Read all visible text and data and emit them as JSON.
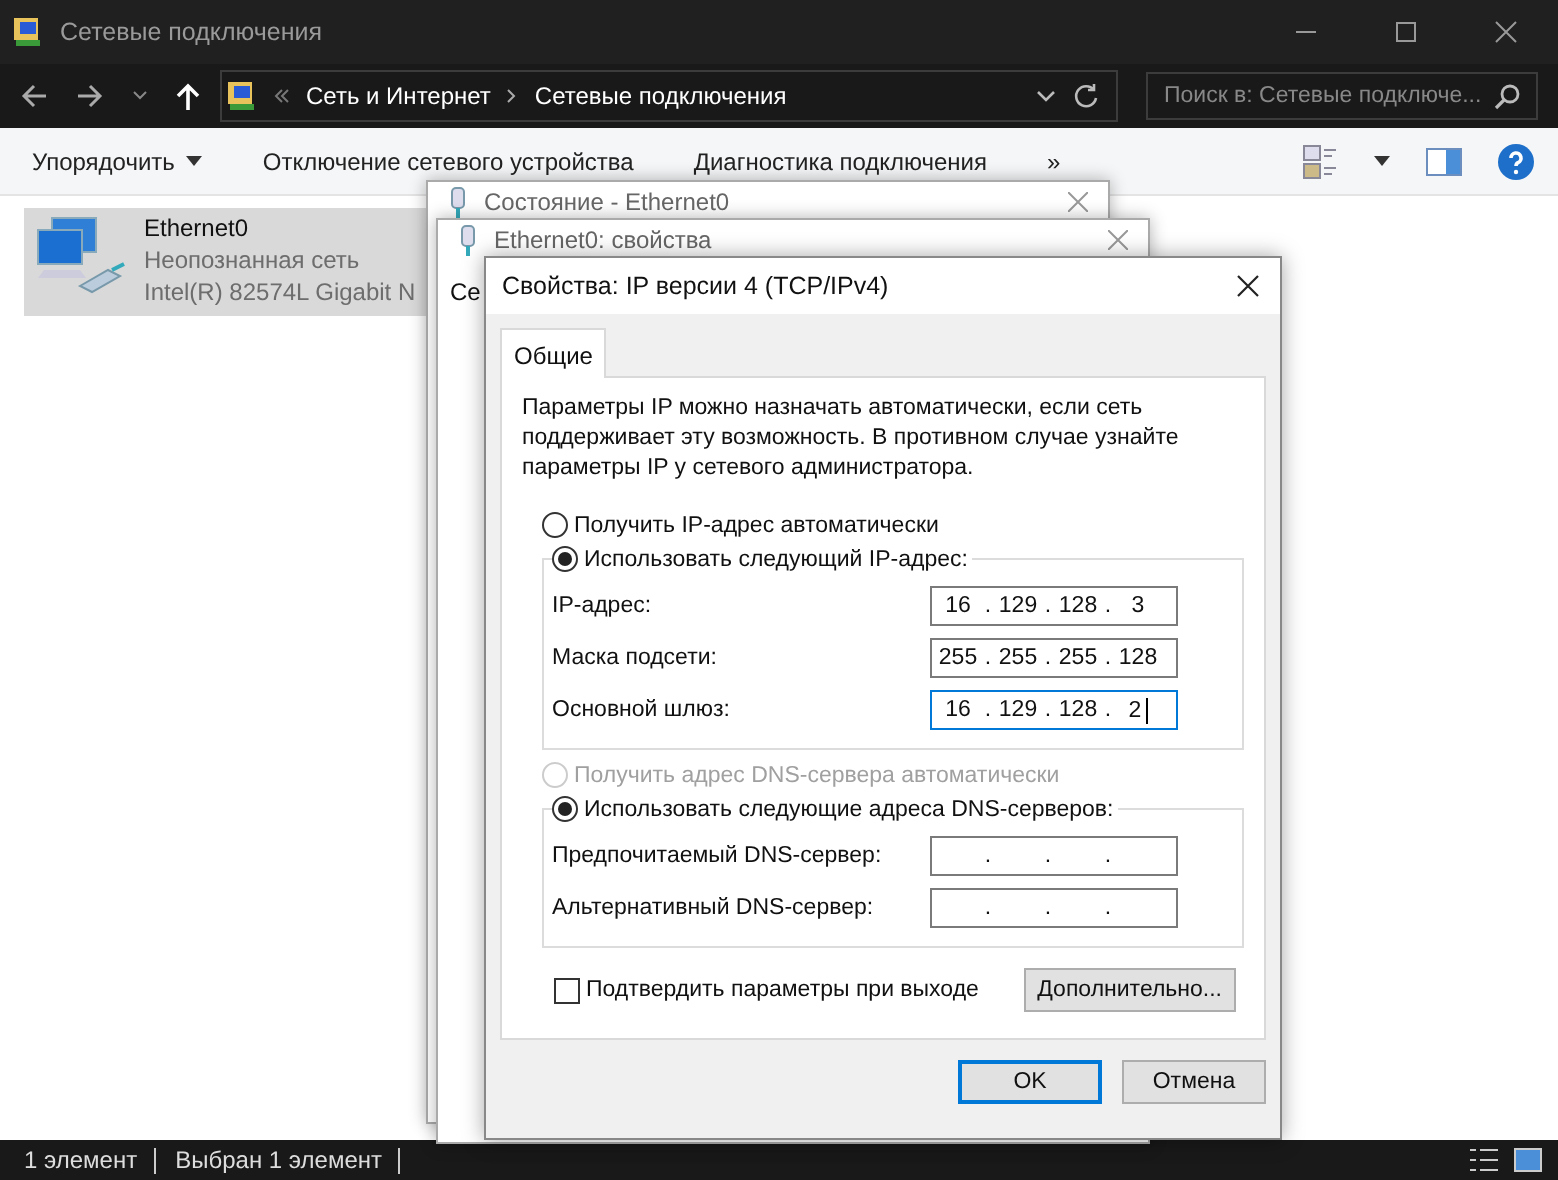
{
  "window": {
    "title": "Сетевые подключения"
  },
  "address": {
    "crumbs": [
      "Сеть и Интернет",
      "Сетевые подключения"
    ],
    "search_placeholder": "Поиск в: Сетевые подключе..."
  },
  "commands": [
    "Упорядочить",
    "Отключение сетевого устройства",
    "Диагностика подключения",
    "»"
  ],
  "items": [
    {
      "name": "Ethernet0",
      "status": "Неопознанная сеть",
      "adapter": "Intel(R) 82574L Gigabit N",
      "selected": true
    }
  ],
  "back_dialogs": [
    {
      "title": "Состояние - Ethernet0"
    },
    {
      "title": "Ethernet0: свойства",
      "tab": "Се"
    }
  ],
  "dialog": {
    "title": "Свойства: IP версии 4 (TCP/IPv4)",
    "tabs": [
      {
        "label": "Общие",
        "selected": true
      }
    ],
    "intro": "Параметры IP можно назначать автоматически, если сеть поддерживает эту возможность. В противном случае узнайте параметры IP у сетевого администратора.",
    "ip_modes": [
      {
        "label": "Получить IP-адрес автоматически",
        "selected": false,
        "disabled": false
      },
      {
        "label": "Использовать следующий IP-адрес:",
        "selected": true,
        "disabled": false
      }
    ],
    "ip_fields": [
      {
        "label": "IP-адрес:",
        "octets": [
          "16",
          "129",
          "128",
          "3"
        ],
        "focused": false
      },
      {
        "label": "Маска подсети:",
        "octets": [
          "255",
          "255",
          "255",
          "128"
        ],
        "focused": false
      },
      {
        "label": "Основной шлюз:",
        "octets": [
          "16",
          "129",
          "128",
          "2"
        ],
        "focused": true
      }
    ],
    "dns_modes": [
      {
        "label": "Получить адрес DNS-сервера автоматически",
        "selected": false,
        "disabled": true
      },
      {
        "label": "Использовать следующие адреса DNS-серверов:",
        "selected": true,
        "disabled": false
      }
    ],
    "dns_fields": [
      {
        "label": "Предпочитаемый DNS-сервер:",
        "focused": false
      },
      {
        "label": "Альтернативный DNS-сервер:",
        "focused": false
      }
    ],
    "separator": ".",
    "validate": {
      "label": "Подтвердить параметры при выходе",
      "checked": false
    },
    "advanced_button": "Дополнительно...",
    "buttons": [
      {
        "label": "OK",
        "default": true
      },
      {
        "label": "Отмена",
        "default": false
      }
    ]
  },
  "status_bar": [
    "1 элемент",
    "Выбран 1 элемент"
  ]
}
